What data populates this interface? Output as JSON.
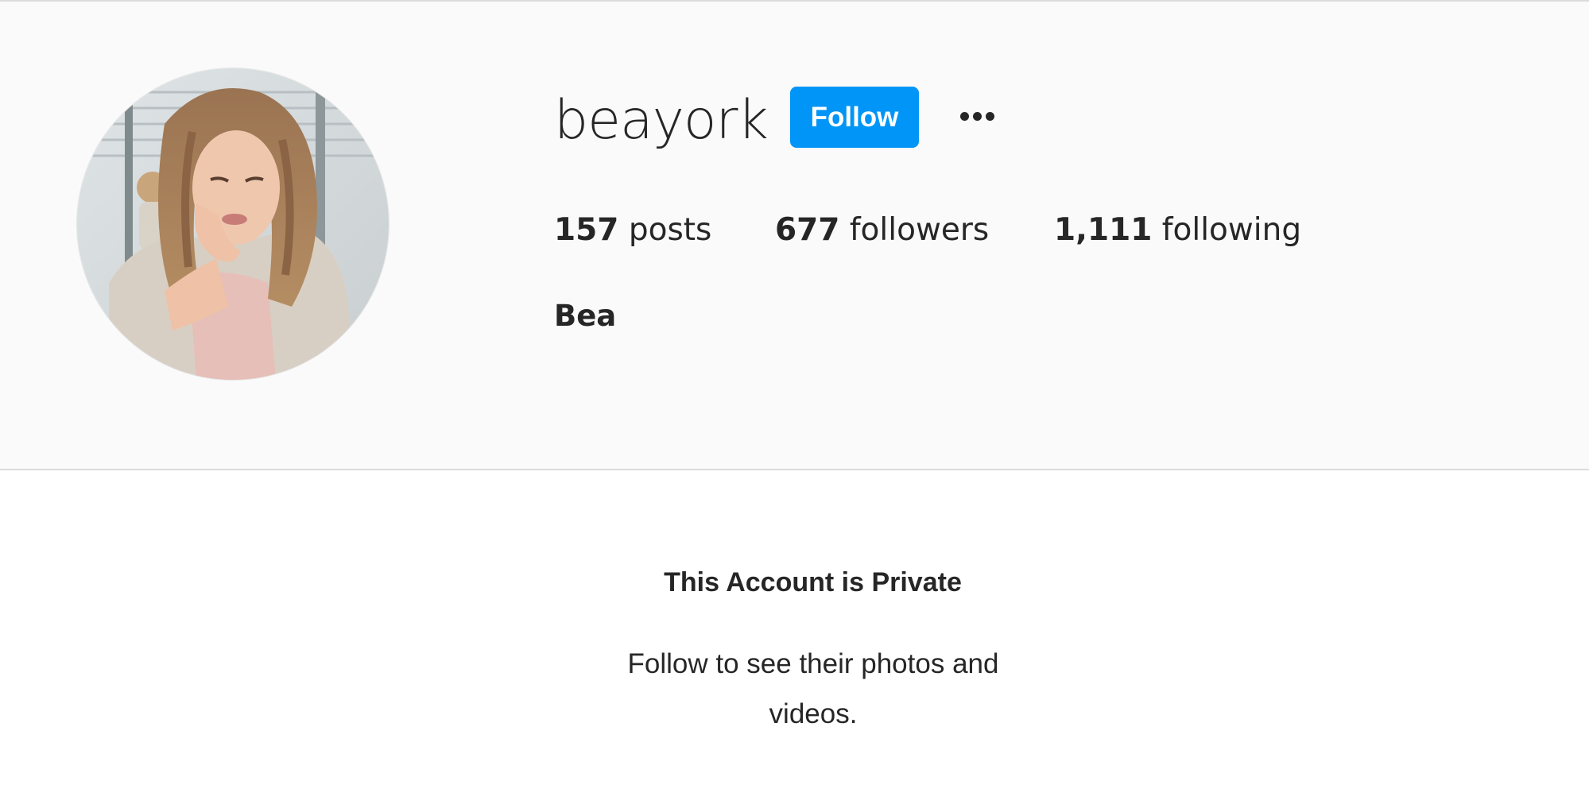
{
  "profile": {
    "username": "beayork",
    "follow_label": "Follow",
    "more_icon": "more-horizontal-icon",
    "full_name": "Bea",
    "accent_color": "#0095f6",
    "stats": {
      "posts": {
        "count": "157",
        "label": "posts"
      },
      "followers": {
        "count": "677",
        "label": "followers"
      },
      "following": {
        "count": "1,111",
        "label": "following"
      }
    }
  },
  "private_notice": {
    "title": "This Account is Private",
    "message": "Follow to see their photos and videos."
  }
}
